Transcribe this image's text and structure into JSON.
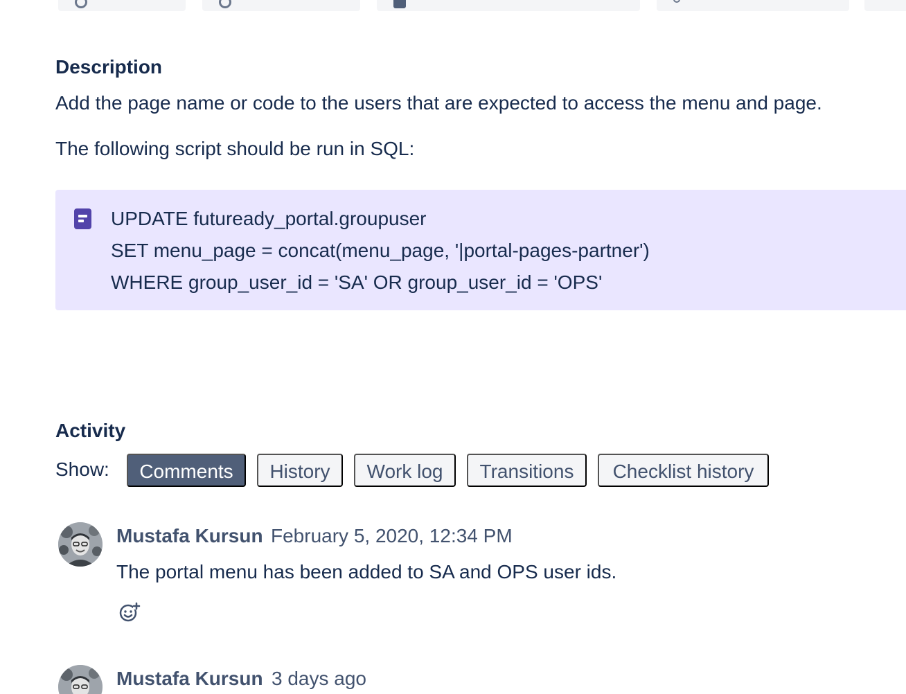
{
  "description": {
    "title": "Description",
    "paragraph_1": "Add the page name or code to the users that are expected to access the menu and page.",
    "paragraph_2": "The following script should be run in SQL:",
    "code_lines": [
      "UPDATE futuready_portal.groupuser",
      "SET menu_page = concat(menu_page, '|portal-pages-partner')",
      "WHERE group_user_id = 'SA' OR group_user_id = 'OPS'"
    ],
    "panel_icon": "note-icon"
  },
  "activity": {
    "title": "Activity",
    "show_label": "Show:",
    "filters": [
      {
        "label": "Comments",
        "active": true
      },
      {
        "label": "History",
        "active": false
      },
      {
        "label": "Work log",
        "active": false
      },
      {
        "label": "Transitions",
        "active": false
      },
      {
        "label": "Checklist history",
        "active": false
      }
    ]
  },
  "comments": [
    {
      "author": "Mustafa Kursun",
      "timestamp": "February 5, 2020, 12:34 PM",
      "body": "The portal menu has been added to SA and OPS user ids.",
      "reaction_icon": "add-reaction-icon"
    },
    {
      "author": "Mustafa Kursun",
      "timestamp": "3 days ago",
      "body": ""
    }
  ],
  "colors": {
    "text_primary": "#172b4d",
    "text_secondary": "#42526e",
    "panel_background": "#eae6ff",
    "panel_icon": "#5243aa",
    "active_filter": "#505f79",
    "inactive_filter": "#f4f5f7"
  }
}
